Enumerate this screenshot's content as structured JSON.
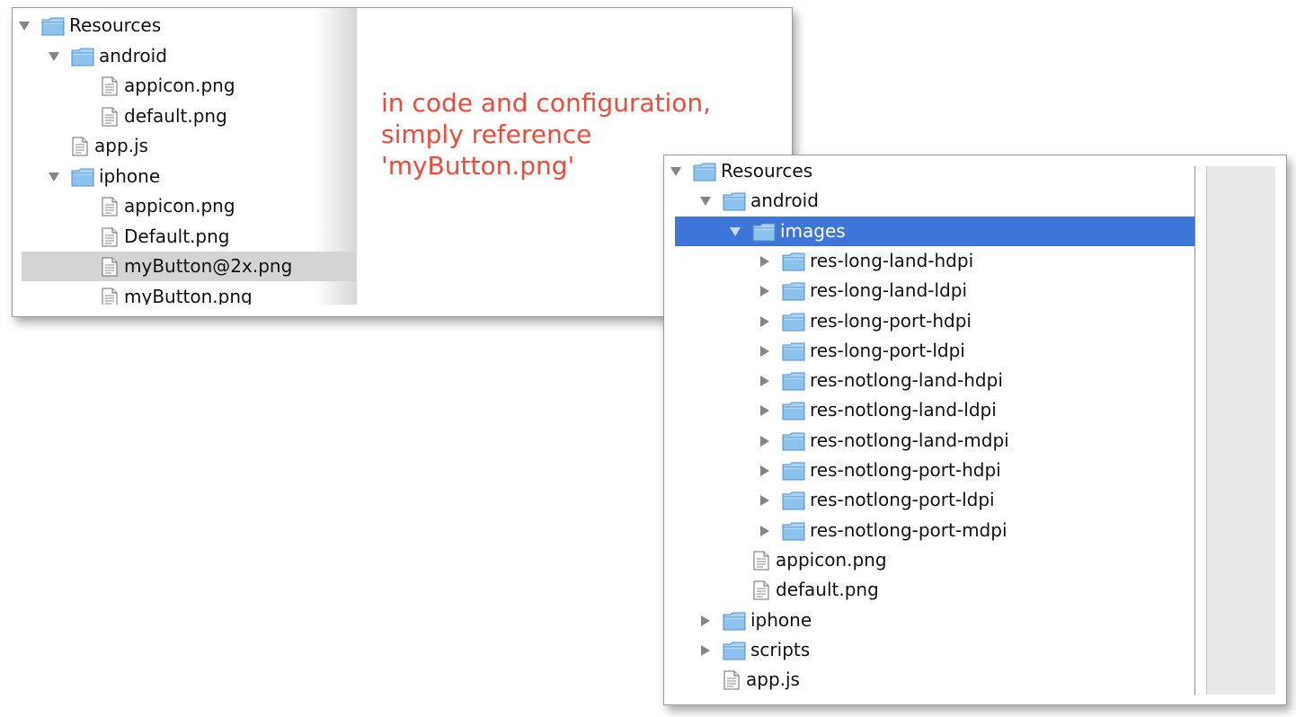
{
  "annotation": {
    "line1": "in code and configuration,",
    "line2": "simply reference",
    "line3": "'myButton.png'"
  },
  "panel1": {
    "tree": [
      {
        "label": "Resources",
        "type": "folder",
        "expanded": true,
        "depth": 0
      },
      {
        "label": "android",
        "type": "folder",
        "expanded": true,
        "depth": 1
      },
      {
        "label": "appicon.png",
        "type": "file",
        "depth": 2
      },
      {
        "label": "default.png",
        "type": "file",
        "depth": 2
      },
      {
        "label": "app.js",
        "type": "file",
        "depth": 1
      },
      {
        "label": "iphone",
        "type": "folder",
        "expanded": true,
        "depth": 1
      },
      {
        "label": "appicon.png",
        "type": "file",
        "depth": 2
      },
      {
        "label": "Default.png",
        "type": "file",
        "depth": 2
      },
      {
        "label": "myButton@2x.png",
        "type": "file",
        "depth": 2,
        "selected": true
      },
      {
        "label": "myButton.png",
        "type": "file",
        "depth": 2
      }
    ]
  },
  "panel2": {
    "tree": [
      {
        "label": "Resources",
        "type": "folder",
        "expanded": true,
        "depth": 0
      },
      {
        "label": "android",
        "type": "folder",
        "expanded": true,
        "depth": 1
      },
      {
        "label": "images",
        "type": "folder",
        "expanded": true,
        "depth": 2,
        "selected": true
      },
      {
        "label": "res-long-land-hdpi",
        "type": "folder",
        "expanded": false,
        "depth": 3
      },
      {
        "label": "res-long-land-ldpi",
        "type": "folder",
        "expanded": false,
        "depth": 3
      },
      {
        "label": "res-long-port-hdpi",
        "type": "folder",
        "expanded": false,
        "depth": 3
      },
      {
        "label": "res-long-port-ldpi",
        "type": "folder",
        "expanded": false,
        "depth": 3
      },
      {
        "label": "res-notlong-land-hdpi",
        "type": "folder",
        "expanded": false,
        "depth": 3
      },
      {
        "label": "res-notlong-land-ldpi",
        "type": "folder",
        "expanded": false,
        "depth": 3
      },
      {
        "label": "res-notlong-land-mdpi",
        "type": "folder",
        "expanded": false,
        "depth": 3
      },
      {
        "label": "res-notlong-port-hdpi",
        "type": "folder",
        "expanded": false,
        "depth": 3
      },
      {
        "label": "res-notlong-port-ldpi",
        "type": "folder",
        "expanded": false,
        "depth": 3
      },
      {
        "label": "res-notlong-port-mdpi",
        "type": "folder",
        "expanded": false,
        "depth": 3
      },
      {
        "label": "appicon.png",
        "type": "file",
        "depth": 2
      },
      {
        "label": "default.png",
        "type": "file",
        "depth": 2
      },
      {
        "label": "iphone",
        "type": "folder",
        "expanded": false,
        "depth": 1
      },
      {
        "label": "scripts",
        "type": "folder",
        "expanded": false,
        "depth": 1
      },
      {
        "label": "app.js",
        "type": "file",
        "depth": 1
      }
    ]
  },
  "colors": {
    "annotation": "#ef4a3a",
    "selection_blue": "#3d75d8",
    "selection_gray": "#d4d4d4",
    "folder_blue": "#8cc3ee"
  }
}
